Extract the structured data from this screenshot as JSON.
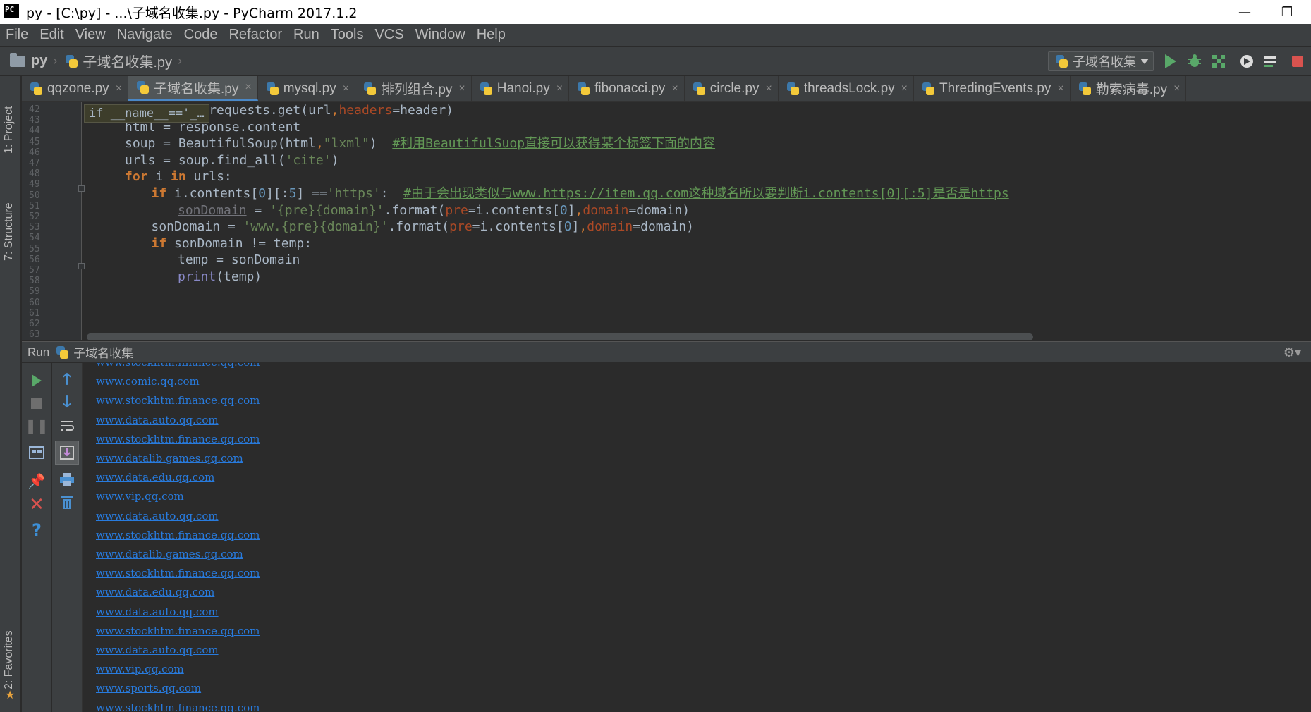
{
  "window": {
    "title": "py - [C:\\py] - ...\\子域名收集.py - PyCharm 2017.1.2",
    "app_icon_text": "PC",
    "minimize_symbol": "—",
    "restore_symbol": "❐"
  },
  "menu": [
    "File",
    "Edit",
    "View",
    "Navigate",
    "Code",
    "Refactor",
    "Run",
    "Tools",
    "VCS",
    "Window",
    "Help"
  ],
  "nav": {
    "project": "py",
    "file": "子域名收集.py",
    "run_config": "子域名收集"
  },
  "left_strip": {
    "project_label": "1: Project",
    "structure_label": "7: Structure",
    "favorites_label": "2: Favorites"
  },
  "tabs": [
    {
      "label": "qqzone.py",
      "active": false
    },
    {
      "label": "子域名收集.py",
      "active": true
    },
    {
      "label": "mysql.py",
      "active": false
    },
    {
      "label": "排列组合.py",
      "active": false
    },
    {
      "label": "Hanoi.py",
      "active": false
    },
    {
      "label": "fibonacci.py",
      "active": false
    },
    {
      "label": "circle.py",
      "active": false
    },
    {
      "label": "threadsLock.py",
      "active": false
    },
    {
      "label": "ThredingEvents.py",
      "active": false
    },
    {
      "label": "勒索病毒.py",
      "active": false
    }
  ],
  "tab_close_symbol": "×",
  "editor": {
    "sticky_hint": "if __name__=='_…",
    "line_numbers": [
      "42",
      "43",
      "44",
      "45",
      "46",
      "47",
      "48",
      "49",
      "50",
      "51",
      "52",
      "53",
      "54",
      "55",
      "56",
      "57",
      "58",
      "59",
      "60",
      "61",
      "62",
      "63"
    ],
    "code": {
      "l1_a": "response = requests.get(url",
      "l1_b": ",",
      "l1_c": "headers",
      "l1_d": "=header)",
      "l2": "html = response.content",
      "l3_a": "soup = BeautifulSoup(html",
      "l3_b": ",",
      "l3_c": "\"lxml\"",
      "l3_d": ")  ",
      "l3_e": "#利用BeautifulSuop直接可以获得某个标签下面的内容",
      "l4_a": "urls = soup.find_all(",
      "l4_b": "'cite'",
      "l4_c": ")",
      "l5_a": "for",
      "l5_b": " i ",
      "l5_c": "in",
      "l5_d": " urls:",
      "l6_a": "if",
      "l6_b": " i.contents[",
      "l6_c": "0",
      "l6_d": "][:",
      "l6_e": "5",
      "l6_f": "] ==",
      "l6_g": "'https'",
      "l6_h": ":  ",
      "l6_i": "#由于会出现类似与www.https://item.qq.com这种域名所以要判断i.contents[0][:5]是否是https",
      "l7_a": "sonDomain",
      "l7_b": " = ",
      "l7_c": "'{pre}{domain}'",
      "l7_d": ".format(",
      "l7_e": "pre",
      "l7_f": "=i.contents[",
      "l7_g": "0",
      "l7_h": "]",
      "l7_i": ",",
      "l7_j": "domain",
      "l7_k": "=domain)",
      "l8_a": "sonDomain = ",
      "l8_b": "'www.{pre}{domain}'",
      "l8_c": ".format(",
      "l8_d": "pre",
      "l8_e": "=i.contents[",
      "l8_f": "0",
      "l8_g": "]",
      "l8_h": ",",
      "l8_i": "domain",
      "l8_j": "=domain)",
      "l9_a": "if",
      "l9_b": " sonDomain != temp:",
      "l10": "temp = sonDomain",
      "l11_a": "print",
      "l11_b": "(temp)"
    }
  },
  "run": {
    "label": "Run",
    "config": "子域名收集",
    "gear_symbol": "⚙▾",
    "output": [
      "www.stockhtm.finance.qq.com",
      "www.comic.qq.com",
      "www.stockhtm.finance.qq.com",
      "www.data.auto.qq.com",
      "www.stockhtm.finance.qq.com",
      "www.datalib.games.qq.com",
      "www.data.edu.qq.com",
      "www.vip.qq.com",
      "www.data.auto.qq.com",
      "www.stockhtm.finance.qq.com",
      "www.datalib.games.qq.com",
      "www.stockhtm.finance.qq.com",
      "www.data.edu.qq.com",
      "www.data.auto.qq.com",
      "www.stockhtm.finance.qq.com",
      "www.data.auto.qq.com",
      "www.vip.qq.com",
      "www.sports.qq.com",
      "www.stockhtm.finance.qq.com"
    ]
  },
  "colors": {
    "background": "#2b2b2b",
    "panel": "#3c3f41",
    "keyword": "#cc7832",
    "string": "#6a8759",
    "number": "#6897bb",
    "comment": "#629755",
    "link": "#287bde"
  }
}
